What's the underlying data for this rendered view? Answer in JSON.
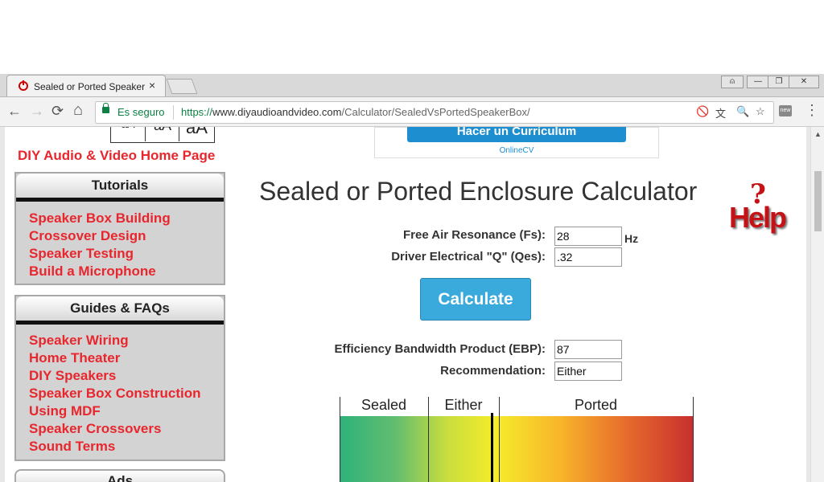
{
  "browser": {
    "tab_title": "Sealed or Ported Speaker",
    "tab_close": "×",
    "secure_label": "Es seguro",
    "url_proto": "https://",
    "url_host": "www.diyaudioandvideo.com",
    "url_path": "/Calculator/SealedVsPortedSpeakerBox/",
    "nav": {
      "back": "←",
      "forward": "→",
      "reload": "⟳",
      "home": "⌂"
    },
    "menu": "⋮",
    "window_controls": {
      "user": "⍝",
      "minimize": "—",
      "restore": "❐",
      "close": "✕"
    }
  },
  "sidebar": {
    "font_size_controls": [
      "aA",
      "aA",
      "aA"
    ],
    "home_link": "DIY Audio & Video Home Page",
    "tutorials": {
      "title": "Tutorials",
      "items": [
        "Speaker Box Building",
        "Crossover Design",
        "Speaker Testing",
        "Build a Microphone"
      ]
    },
    "guides": {
      "title": "Guides & FAQs",
      "items": [
        "Speaker Wiring",
        "Home Theater",
        "DIY Speakers",
        "Speaker Box Construction",
        "Using MDF",
        "Speaker Crossovers",
        "Sound Terms"
      ]
    },
    "ads_title": "Ads"
  },
  "ad": {
    "button": "Hacer un Currículum",
    "brand": "OnlineCV"
  },
  "main": {
    "title": "Sealed or Ported Enclosure Calculator",
    "help_q": "?",
    "help_text": "Help",
    "fs_label": "Free Air Resonance (Fs):",
    "fs_value": "28",
    "fs_unit": "Hz",
    "qes_label": "Driver Electrical \"Q\" (Qes):",
    "qes_value": ".32",
    "calculate_button": "Calculate",
    "ebp_label": "Efficiency Bandwidth Product (EBP):",
    "ebp_value": "87",
    "recommendation_label": "Recommendation:",
    "recommendation_value": "Either"
  },
  "scale": {
    "labels": [
      "Sealed",
      "Either",
      "Ported"
    ],
    "marker_fraction": 0.428
  }
}
